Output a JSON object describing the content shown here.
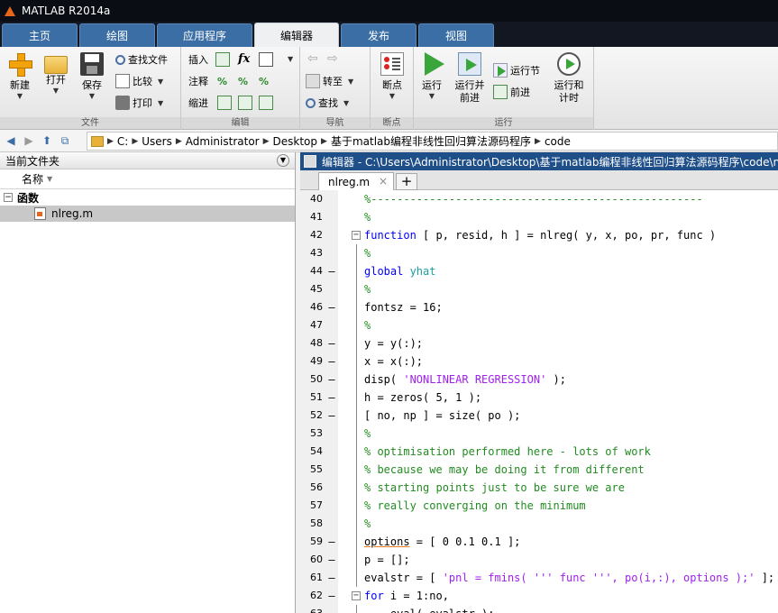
{
  "window": {
    "title": "MATLAB R2014a"
  },
  "ribbon_tabs": [
    {
      "label": "主页"
    },
    {
      "label": "绘图"
    },
    {
      "label": "应用程序"
    },
    {
      "label": "编辑器",
      "active": true
    },
    {
      "label": "发布"
    },
    {
      "label": "视图"
    }
  ],
  "toolstrip": {
    "file_group": "文件",
    "new": "新建",
    "open": "打开",
    "save": "保存",
    "find_files": "查找文件",
    "compare": "比较",
    "print": "打印",
    "insert": "插入",
    "fx": "fx",
    "comment": "注释",
    "indent": "缩进",
    "edit_group": "编辑",
    "goto": "转至",
    "find": "查找",
    "nav_group": "导航",
    "breakpoints": "断点",
    "bp_group": "断点",
    "run": "运行",
    "run_advance_1": "运行并",
    "run_advance_2": "前进",
    "run_section": "运行节",
    "advance": "前进",
    "run_time_1": "运行和",
    "run_time_2": "计时",
    "run_group": "运行"
  },
  "path": [
    "C:",
    "Users",
    "Administrator",
    "Desktop",
    "基于matlab编程非线性回归算法源码程序",
    "code"
  ],
  "file_browser": {
    "title": "当前文件夹",
    "column": "名称",
    "group": "函数",
    "files": [
      "nlreg.m"
    ]
  },
  "editor": {
    "title": "编辑器 - C:\\Users\\Administrator\\Desktop\\基于matlab编程非线性回归算法源码程序\\code\\nlreg.m",
    "tab": "nlreg.m",
    "lines": [
      {
        "n": "40",
        "text": "%---------------------------------------------------",
        "type": "comment"
      },
      {
        "n": "41",
        "text": "%",
        "type": "comment"
      },
      {
        "n": "42",
        "kw": "function",
        "text": " [ p, resid, h ] = nlreg( y, x, po, pr, func )",
        "fold": "start"
      },
      {
        "n": "43",
        "text": "%",
        "type": "comment"
      },
      {
        "n": "44",
        "kw": "global",
        "glob": " yhat",
        "text": "",
        "mark": "–"
      },
      {
        "n": "45",
        "text": "%",
        "type": "comment"
      },
      {
        "n": "46",
        "text": "fontsz = 16;",
        "mark": "–"
      },
      {
        "n": "47",
        "text": "%",
        "type": "comment"
      },
      {
        "n": "48",
        "text": "y = y(:);",
        "mark": "–"
      },
      {
        "n": "49",
        "text": "x = x(:);",
        "mark": "–"
      },
      {
        "n": "50",
        "pre": "disp( ",
        "str": "'NONLINEAR REGRESSION'",
        "text": " );",
        "mark": "–"
      },
      {
        "n": "51",
        "text": "h = zeros( 5, 1 );",
        "mark": "–"
      },
      {
        "n": "52",
        "text": "[ no, np ] = size( po );",
        "mark": "–"
      },
      {
        "n": "53",
        "text": "%",
        "type": "comment"
      },
      {
        "n": "54",
        "text": "% optimisation performed here - lots of work",
        "type": "comment"
      },
      {
        "n": "55",
        "text": "% because we may be doing it from different",
        "type": "comment"
      },
      {
        "n": "56",
        "text": "% starting points just to be sure we are",
        "type": "comment"
      },
      {
        "n": "57",
        "text": "% really converging on the minimum",
        "type": "comment"
      },
      {
        "n": "58",
        "text": "%",
        "type": "comment"
      },
      {
        "n": "59",
        "squig": "options",
        "text": " = [ 0 0.1 0.1 ];",
        "mark": "–"
      },
      {
        "n": "60",
        "text": "p = [];",
        "mark": "–"
      },
      {
        "n": "61",
        "pre": "evalstr = [ ",
        "str": "'pnl = fmins( ''' func ''', po(i,:), options );'",
        "text": " ];",
        "mark": "–"
      },
      {
        "n": "62",
        "kw": "for",
        "text": " i = 1:no,",
        "mark": "–",
        "fold": "start"
      },
      {
        "n": "63",
        "text": "    eval( evalstr );",
        "mark": "–"
      }
    ]
  }
}
